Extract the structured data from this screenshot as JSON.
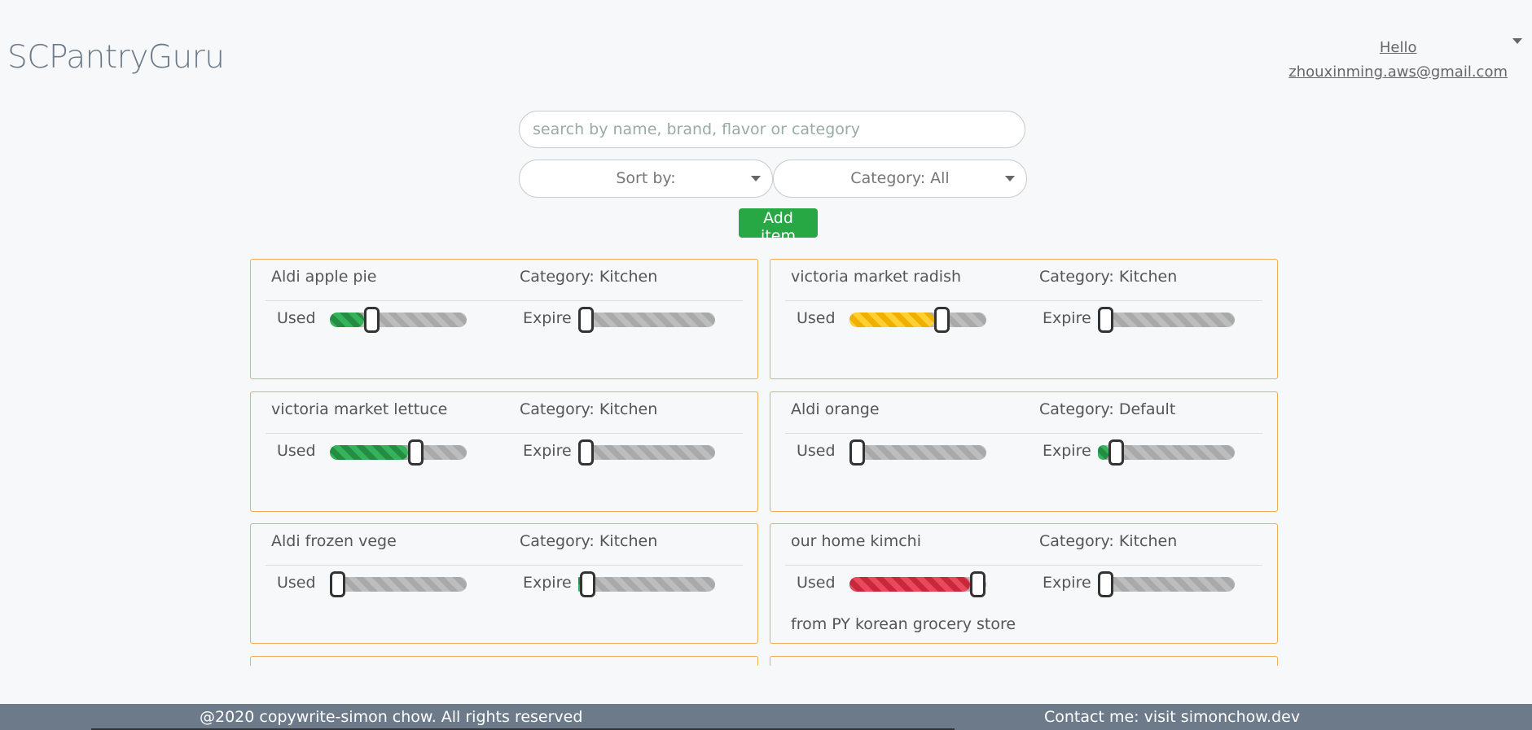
{
  "header": {
    "brand": "SCPantryGuru",
    "greeting": "Hello",
    "email": "zhouxinming.aws@gmail.com"
  },
  "search": {
    "placeholder": "search by name, brand, flavor or category"
  },
  "sort": {
    "label": "Sort by:"
  },
  "category_filter": {
    "label": "Category: All"
  },
  "add_button": {
    "label": "Add item"
  },
  "labels": {
    "used": "Used",
    "expire": "Expire"
  },
  "items": [
    {
      "name": "Aldi apple pie",
      "category": "Category: Kitchen",
      "used": 0.25,
      "used_color": "green",
      "expire": 0.0,
      "expire_color": "green",
      "note": ""
    },
    {
      "name": "victoria market radish",
      "category": "Category: Kitchen",
      "used": 0.62,
      "used_color": "yellow",
      "expire": 0.0,
      "expire_color": "green",
      "note": ""
    },
    {
      "name": "victoria market lettuce",
      "category": "Category: Kitchen",
      "used": 0.57,
      "used_color": "green",
      "expire": 0.0,
      "expire_color": "green",
      "note": ""
    },
    {
      "name": "Aldi orange",
      "category": "Category: Default",
      "used": 0.0,
      "used_color": "green",
      "expire": 0.08,
      "expire_color": "green",
      "note": ""
    },
    {
      "name": "Aldi frozen vege",
      "category": "Category: Kitchen",
      "used": 0.0,
      "used_color": "green",
      "expire": 0.01,
      "expire_color": "green",
      "note": ""
    },
    {
      "name": "our home kimchi",
      "category": "Category: Kitchen",
      "used": 0.88,
      "used_color": "red",
      "expire": 0.0,
      "expire_color": "green",
      "note": "from PY korean grocery store"
    }
  ],
  "footer": {
    "copyright": "@2020 copywrite-simon chow. All rights reserved",
    "contact": "Contact me: visit simonchow.dev"
  }
}
